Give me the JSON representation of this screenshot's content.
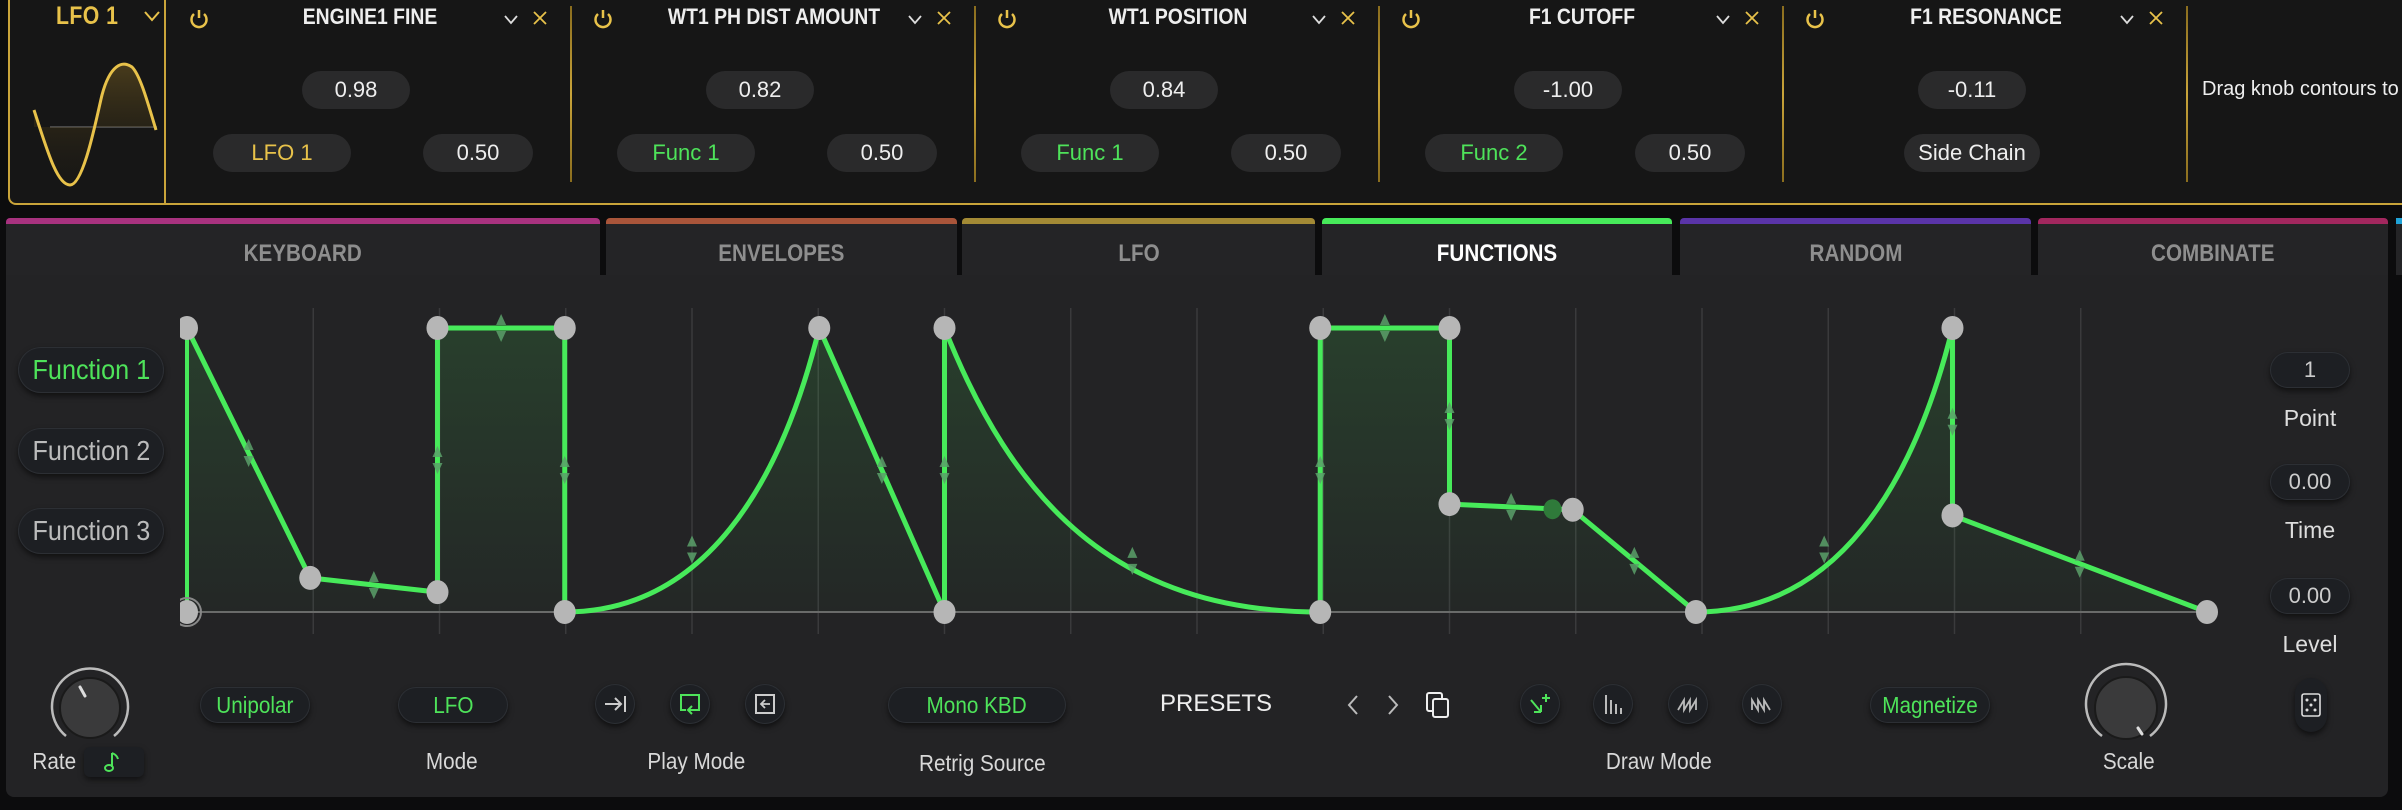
{
  "mod_bar": {
    "source": {
      "label": "LFO 1",
      "icon": "chevron-down-icon",
      "waveform": "sine"
    },
    "slots": [
      {
        "title": "ENGINE1 FINE",
        "amount": "0.98",
        "source": "LFO 1",
        "source_color": "gold",
        "depth": "0.50"
      },
      {
        "title": "WT1 PH DIST AMOUNT",
        "amount": "0.82",
        "source": "Func 1",
        "source_color": "green",
        "depth": "0.50"
      },
      {
        "title": "WT1 POSITION",
        "amount": "0.84",
        "source": "Func 1",
        "source_color": "green",
        "depth": "0.50"
      },
      {
        "title": "F1 CUTOFF",
        "amount": "-1.00",
        "source": "Func 2",
        "source_color": "green",
        "depth": "0.50"
      },
      {
        "title": "F1 RESONANCE",
        "amount": "-0.11",
        "source": "Side Chain",
        "source_color": "white",
        "depth": null
      }
    ],
    "hint": "Drag knob contours to"
  },
  "tabs": [
    {
      "label": "KEYBOARD",
      "color": "#a8327f",
      "active": false
    },
    {
      "label": "ENVELOPES",
      "color": "#a9553a",
      "active": false
    },
    {
      "label": "LFO",
      "color": "#a38a35",
      "active": false
    },
    {
      "label": "FUNCTIONS",
      "color": "#47ea5a",
      "active": true
    },
    {
      "label": "RANDOM",
      "color": "#5a34a8",
      "active": false
    },
    {
      "label": "COMBINATE",
      "color": "#a2275e",
      "active": false
    }
  ],
  "functions": {
    "list": [
      {
        "label": "Function 1",
        "active": true
      },
      {
        "label": "Function 2",
        "active": false
      },
      {
        "label": "Function 3",
        "active": false
      }
    ],
    "accent": "#47ea5a",
    "curve": {
      "points": [
        {
          "t": 0.0,
          "v": 1.0
        },
        {
          "t": 0.0,
          "v": 0.0,
          "note": "start"
        },
        {
          "t": 0.061,
          "v": 0.12
        },
        {
          "t": 0.124,
          "v": 0.07
        },
        {
          "t": 0.124,
          "v": 1.0
        },
        {
          "t": 0.187,
          "v": 1.0
        },
        {
          "t": 0.187,
          "v": 0.0
        },
        {
          "t": 0.313,
          "v": 1.0
        },
        {
          "t": 0.375,
          "v": 0.0
        },
        {
          "t": 0.375,
          "v": 1.0
        },
        {
          "t": 0.561,
          "v": 0.0
        },
        {
          "t": 0.561,
          "v": 1.0
        },
        {
          "t": 0.625,
          "v": 1.0
        },
        {
          "t": 0.625,
          "v": 0.38
        },
        {
          "t": 0.686,
          "v": 0.36
        },
        {
          "t": 0.747,
          "v": 0.0
        },
        {
          "t": 0.874,
          "v": 1.0
        },
        {
          "t": 0.874,
          "v": 0.34
        },
        {
          "t": 1.0,
          "v": 0.0
        }
      ],
      "segments": [
        {
          "from": 0,
          "to": 2,
          "shape": "linear"
        },
        {
          "from": 2,
          "to": 3,
          "shape": "linear"
        },
        {
          "from": 3,
          "to": 4,
          "shape": "step"
        },
        {
          "from": 4,
          "to": 5,
          "shape": "linear"
        },
        {
          "from": 5,
          "to": 6,
          "shape": "step"
        },
        {
          "from": 6,
          "to": 7,
          "shape": "exp-up"
        },
        {
          "from": 7,
          "to": 8,
          "shape": "linear"
        },
        {
          "from": 8,
          "to": 9,
          "shape": "step"
        },
        {
          "from": 9,
          "to": 10,
          "shape": "exp-down"
        },
        {
          "from": 10,
          "to": 11,
          "shape": "step"
        },
        {
          "from": 11,
          "to": 12,
          "shape": "linear"
        },
        {
          "from": 12,
          "to": 13,
          "shape": "step"
        },
        {
          "from": 13,
          "to": 14,
          "shape": "linear"
        },
        {
          "from": 14,
          "to": 15,
          "shape": "linear"
        },
        {
          "from": 15,
          "to": 16,
          "shape": "exp-up"
        },
        {
          "from": 16,
          "to": 17,
          "shape": "step"
        },
        {
          "from": 17,
          "to": 18,
          "shape": "linear"
        }
      ],
      "grid_divisions": 16
    },
    "point_panel": {
      "point": {
        "value": "1",
        "label": "Point"
      },
      "time": {
        "value": "0.00",
        "label": "Time"
      },
      "level": {
        "value": "0.00",
        "label": "Level"
      },
      "randomize_icon": "dice-icon"
    }
  },
  "toolbar": {
    "rate": {
      "label": "Rate",
      "sync_icon": "note-icon"
    },
    "polarity": "Unipolar",
    "mode": {
      "value": "LFO",
      "label": "Mode"
    },
    "play_mode": {
      "label": "Play Mode",
      "icons": [
        "one-shot-icon",
        "loop-icon",
        "loop-back-icon"
      ],
      "active_index": 1
    },
    "retrig": {
      "value": "Mono KBD",
      "label": "Retrig Source"
    },
    "presets": {
      "label": "PRESETS",
      "prev_icon": "chevron-left-icon",
      "next_icon": "chevron-right-icon",
      "copy_icon": "copy-icon"
    },
    "draw_mode": {
      "label": "Draw Mode",
      "icons": [
        "add-point-icon",
        "bars-icon",
        "saw-icon",
        "zigzag-icon"
      ],
      "active_index": 0
    },
    "magnetize": "Magnetize",
    "scale": {
      "label": "Scale"
    }
  }
}
